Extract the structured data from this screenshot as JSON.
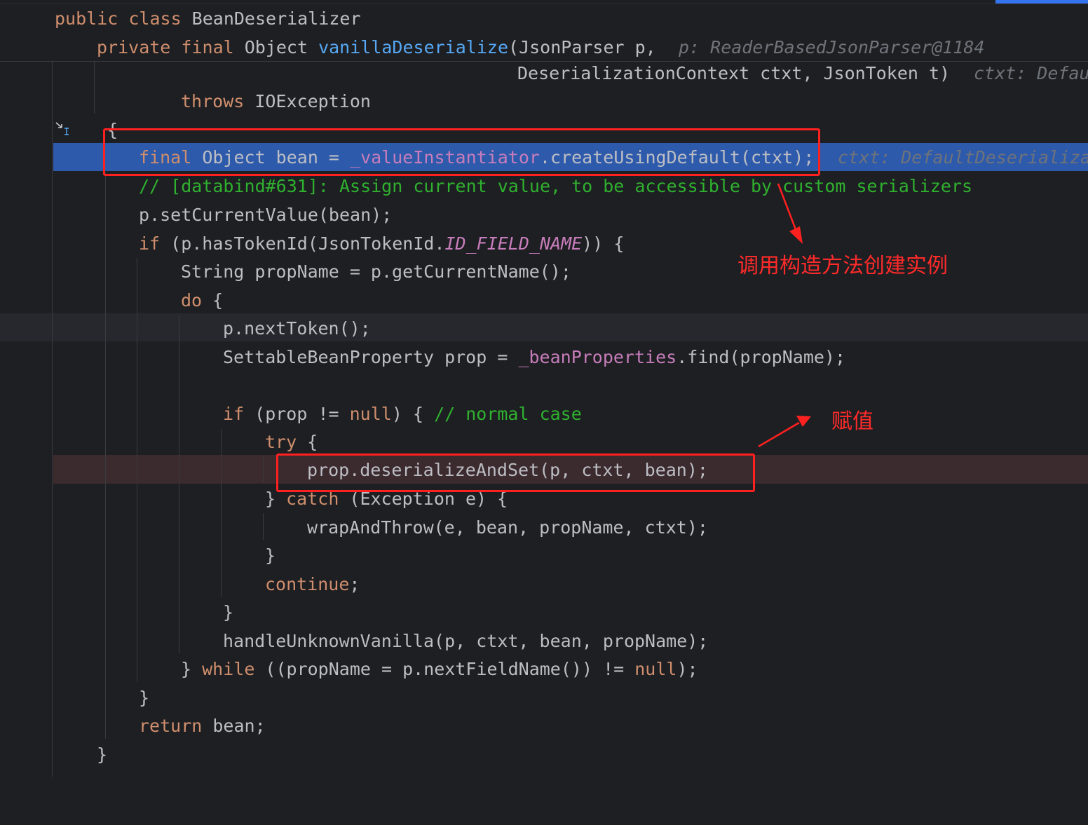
{
  "code": {
    "class_decl": {
      "kw": "public class ",
      "name": "BeanDeserializer"
    },
    "method_decl": {
      "kw": "private final ",
      "type": "Object ",
      "name": "vanillaDeserialize",
      "params1": "(JsonParser p,",
      "hint1": "p: ReaderBasedJsonParser@1184"
    },
    "params2": {
      "text": "DeserializationContext ctxt, JsonToken t)",
      "hint": "ctxt: Defau"
    },
    "throws_line": {
      "kw": "throws ",
      "rest": "IOException"
    },
    "open_brace": "{",
    "exec_line": {
      "kw": "final ",
      "t1": "Object bean = ",
      "field": "_valueInstantiator",
      "t2": ".createUsingDefault(ctxt);",
      "hint": "ctxt: DefaultDeserializa"
    },
    "comment_line": "// [databind#631]: Assign current value, to be accessible by custom serializers",
    "set_current": "p.setCurrentValue(bean);",
    "if_token": {
      "kw": "if ",
      "t1": "(p.hasTokenId(JsonTokenId.",
      "const": "ID_FIELD_NAME",
      "t2": ")) {"
    },
    "propname_line": "String propName = p.getCurrentName();",
    "do_line": {
      "kw": "do ",
      "t": "{"
    },
    "next_token": "p.nextToken();",
    "prop_line": {
      "t1": "SettableBeanProperty prop = ",
      "field": "_beanProperties",
      "t2": ".find(propName);"
    },
    "if_prop": {
      "kw": "if ",
      "t1": "(prop != ",
      "kw2": "null",
      "t2": ") { ",
      "cmt": "// normal case"
    },
    "try_line": {
      "kw": "try ",
      "t": "{"
    },
    "bp_line": "prop.deserializeAndSet(p, ctxt, bean);",
    "catch_line": {
      "t1": "} ",
      "kw": "catch ",
      "t2": "(Exception e) {"
    },
    "wrap_line": "wrapAndThrow(e, bean, propName, ctxt);",
    "close1": "}",
    "continue_line": {
      "kw": "continue",
      "t": ";"
    },
    "close2": "}",
    "handle_line": "handleUnknownVanilla(p, ctxt, bean, propName);",
    "while_line": {
      "t1": "} ",
      "kw": "while ",
      "t2": "((propName = p.nextFieldName()) != ",
      "kw2": "null",
      "t3": ");"
    },
    "close3": "}",
    "return_line": {
      "kw": "return ",
      "t": "bean;"
    },
    "close4": "}"
  },
  "annotations": {
    "create_instance": "调用构造方法创建实例",
    "assign": "赋值"
  },
  "colors": {
    "background": "#1e1f22",
    "execution_highlight": "#2e5aab",
    "breakpoint_line": "#3b2a2e",
    "annotation_red": "#ff2020",
    "keyword": "#cf8e6d",
    "method": "#56a8f5",
    "field": "#c77dbb",
    "comment": "#2fb12f"
  }
}
